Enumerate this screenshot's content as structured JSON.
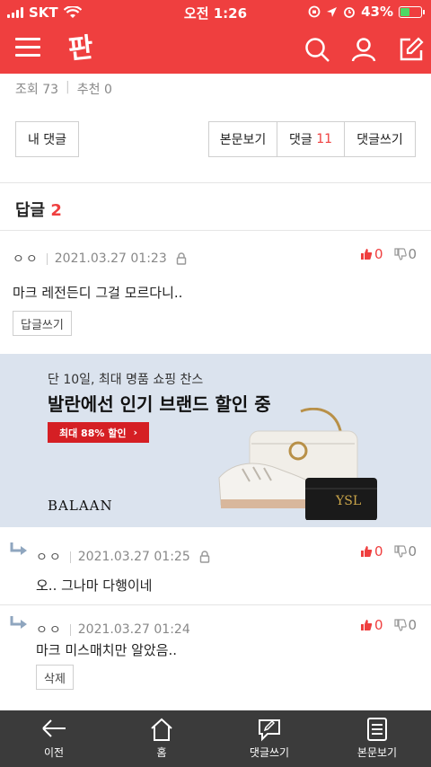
{
  "status_bar": {
    "carrier": "SKT",
    "time": "오전 1:26",
    "battery": "43%",
    "battery_level": 0.43
  },
  "app_bar": {
    "logo": "판",
    "icons": [
      "menu-icon",
      "search-icon",
      "user-icon",
      "write-icon"
    ]
  },
  "post_stats": {
    "views_label": "조회",
    "views": "73",
    "recommend_label": "추천",
    "recommend": "0"
  },
  "buttons": {
    "my_comments": "내 댓글",
    "view_post": "본문보기",
    "comments_label": "댓글",
    "comments_count": "11",
    "write_comment": "댓글쓰기"
  },
  "replies": {
    "title": "답글",
    "count": "2"
  },
  "comments": [
    {
      "author": "ㅇㅇ",
      "date": "2021.03.27 01:23",
      "text": "마크 레전든디 그걸 모르다니..",
      "up": "0",
      "down": "0",
      "action": "답글쓰기"
    },
    {
      "author": "ㅇㅇ",
      "date": "2021.03.27 01:25",
      "text": "오.. 그나마 다행이네",
      "up": "0",
      "down": "0"
    },
    {
      "author": "ㅇㅇ",
      "date": "2021.03.27 01:24",
      "text": "마크 미스매치만 알았음..",
      "up": "0",
      "down": "0",
      "action": "삭제"
    }
  ],
  "ad": {
    "subtitle": "단 10일, 최대 명품 쇼핑 찬스",
    "headline": "발란에선 인기 브랜드 할인 중",
    "cta": "최대 88% 할인",
    "brand": "BALAAN",
    "colors": {
      "background": "#dbe3ee",
      "cta": "#d51f24"
    }
  },
  "tab_bar": {
    "items": [
      {
        "label": "이전",
        "icon": "back-arrow-icon"
      },
      {
        "label": "홈",
        "icon": "home-icon"
      },
      {
        "label": "댓글쓰기",
        "icon": "comment-write-icon"
      },
      {
        "label": "본문보기",
        "icon": "document-icon"
      }
    ]
  },
  "colors": {
    "accent": "#ef3f3f",
    "tabbar": "#3b3b3b"
  }
}
